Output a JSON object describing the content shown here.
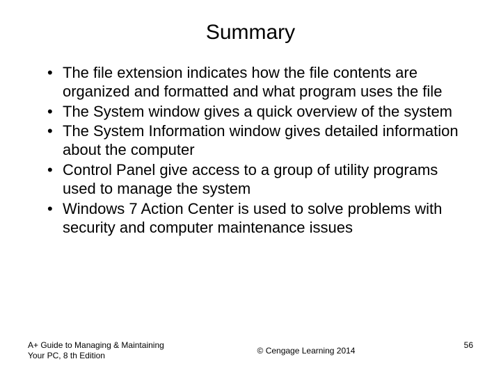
{
  "title": "Summary",
  "bullets": [
    "The file extension indicates how the file contents are organized and formatted and what program uses the file",
    "The System window gives a quick overview of the system",
    "The System Information window gives detailed information about the computer",
    "Control Panel give access to a group of utility programs used to manage the system",
    "Windows 7 Action Center is used to solve problems with security and computer maintenance issues"
  ],
  "footer": {
    "left": "A+ Guide to Managing & Maintaining Your PC, 8 th Edition",
    "center": "© Cengage Learning  2014",
    "right": "56"
  }
}
